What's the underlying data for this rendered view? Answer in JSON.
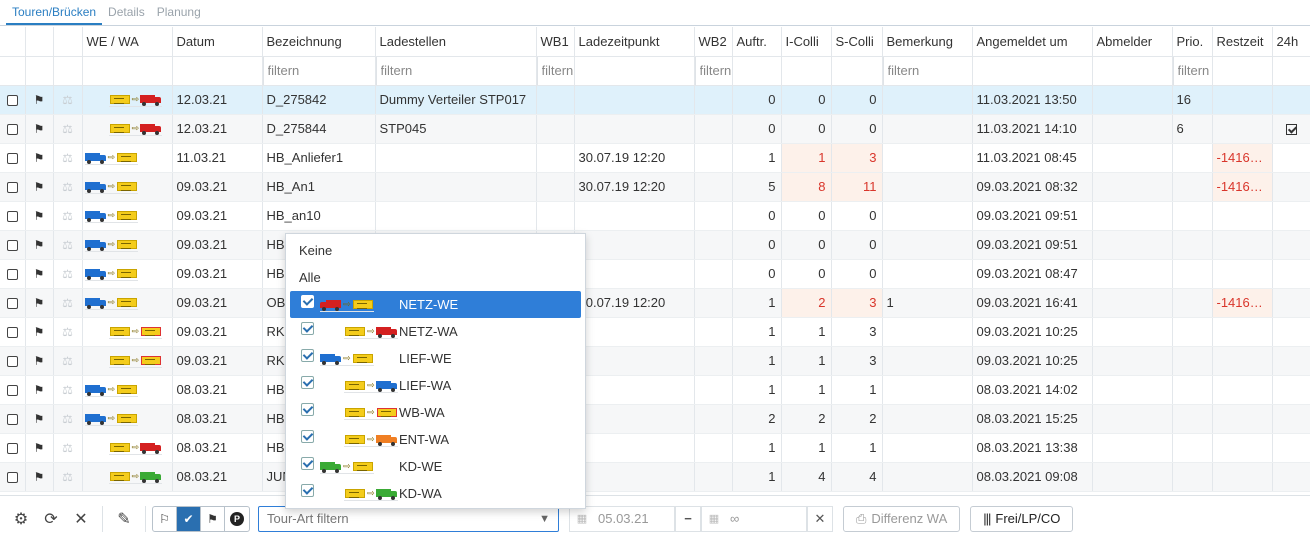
{
  "tabs": [
    "Touren/Brücken",
    "Details",
    "Planung"
  ],
  "columns": {
    "we_wa": "WE / WA",
    "datum": "Datum",
    "bezeichnung": "Bezeichnung",
    "ladestellen": "Ladestellen",
    "wb1": "WB1",
    "ladezeitpunkt": "Ladezeitpunkt",
    "wb2": "WB2",
    "auftr": "Auftr.",
    "icolli": "I-Colli",
    "scolli": "S-Colli",
    "bemerkung": "Bemerkung",
    "angemeldet": "Angemeldet um",
    "abmelder": "Abmelder",
    "prio": "Prio.",
    "restzeit": "Restzeit",
    "h24": "24h"
  },
  "filters": {
    "bezeichnung": "filtern",
    "ladestellen": "filtern",
    "wb1": "filtern",
    "wb2": "filtern",
    "bemerkung": "filtern",
    "prio": "filtern"
  },
  "rows": [
    {
      "tour": "NETZ-WA",
      "datum": "12.03.21",
      "bez": "D_275842",
      "lade": "Dummy Verteiler STP017",
      "ladezeit": "",
      "auftr": "0",
      "icolli": "0",
      "scolli": "0",
      "bem": "",
      "angem": "11.03.2021 13:50",
      "prio": "16",
      "rest": "",
      "h24": false
    },
    {
      "tour": "NETZ-WA",
      "datum": "12.03.21",
      "bez": "D_275844",
      "lade": "STP045",
      "ladezeit": "",
      "auftr": "0",
      "icolli": "0",
      "scolli": "0",
      "bem": "",
      "angem": "11.03.2021 14:10",
      "prio": "6",
      "rest": "",
      "h24": true
    },
    {
      "tour": "LIEF-WE",
      "datum": "11.03.21",
      "bez": "HB_Anliefer1",
      "lade": "",
      "ladezeit": "30.07.19 12:20",
      "auftr": "1",
      "icolli": "1",
      "scolli": "3",
      "bem": "",
      "angem": "11.03.2021 08:45",
      "prio": "",
      "rest": "-1416…",
      "h24": false
    },
    {
      "tour": "LIEF-WE",
      "datum": "09.03.21",
      "bez": "HB_An1",
      "lade": "",
      "ladezeit": "30.07.19 12:20",
      "auftr": "5",
      "icolli": "8",
      "scolli": "11",
      "bem": "",
      "angem": "09.03.2021 08:32",
      "prio": "",
      "rest": "-1416…",
      "h24": false
    },
    {
      "tour": "LIEF-WE",
      "datum": "09.03.21",
      "bez": "HB_an10",
      "lade": "",
      "ladezeit": "",
      "auftr": "0",
      "icolli": "0",
      "scolli": "0",
      "bem": "",
      "angem": "09.03.2021 09:51",
      "prio": "",
      "rest": "",
      "h24": false
    },
    {
      "tour": "LIEF-WE",
      "datum": "09.03.21",
      "bez": "HB",
      "lade": "",
      "ladezeit": "",
      "auftr": "0",
      "icolli": "0",
      "scolli": "0",
      "bem": "",
      "angem": "09.03.2021 09:51",
      "prio": "",
      "rest": "",
      "h24": false
    },
    {
      "tour": "LIEF-WE",
      "datum": "09.03.21",
      "bez": "HB",
      "lade": "",
      "ladezeit": "",
      "auftr": "0",
      "icolli": "0",
      "scolli": "0",
      "bem": "",
      "angem": "09.03.2021 08:47",
      "prio": "",
      "rest": "",
      "h24": false
    },
    {
      "tour": "LIEF-WE",
      "datum": "09.03.21",
      "bez": "OB",
      "lade": "",
      "ladezeit": "30.07.19 12:20",
      "auftr": "1",
      "icolli": "2",
      "scolli": "3",
      "bem": "1",
      "angem": "09.03.2021 16:41",
      "prio": "",
      "rest": "-1416…",
      "h24": false
    },
    {
      "tour": "WB-WA",
      "datum": "09.03.21",
      "bez": "RK",
      "lade": "",
      "ladezeit": "",
      "auftr": "1",
      "icolli": "1",
      "scolli": "3",
      "bem": "",
      "angem": "09.03.2021 10:25",
      "prio": "",
      "rest": "",
      "h24": false
    },
    {
      "tour": "WB-WA",
      "datum": "09.03.21",
      "bez": "RK",
      "lade": "",
      "ladezeit": "",
      "auftr": "1",
      "icolli": "1",
      "scolli": "3",
      "bem": "",
      "angem": "09.03.2021 10:25",
      "prio": "",
      "rest": "",
      "h24": false
    },
    {
      "tour": "LIEF-WE",
      "datum": "08.03.21",
      "bez": "HB",
      "lade": "",
      "ladezeit": "",
      "auftr": "1",
      "icolli": "1",
      "scolli": "1",
      "bem": "",
      "angem": "08.03.2021 14:02",
      "prio": "",
      "rest": "",
      "h24": false
    },
    {
      "tour": "LIEF-WE",
      "datum": "08.03.21",
      "bez": "HB",
      "lade": "",
      "ladezeit": "",
      "auftr": "2",
      "icolli": "2",
      "scolli": "2",
      "bem": "",
      "angem": "08.03.2021 15:25",
      "prio": "",
      "rest": "",
      "h24": false
    },
    {
      "tour": "NETZ-WA",
      "datum": "08.03.21",
      "bez": "HB",
      "lade": "",
      "ladezeit": "",
      "auftr": "1",
      "icolli": "1",
      "scolli": "1",
      "bem": "",
      "angem": "08.03.2021 13:38",
      "prio": "",
      "rest": "",
      "h24": false
    },
    {
      "tour": "KD-WA",
      "datum": "08.03.21",
      "bez": "JUN",
      "lade": "",
      "ladezeit": "",
      "auftr": "1",
      "icolli": "4",
      "scolli": "4",
      "bem": "",
      "angem": "08.03.2021 09:08",
      "prio": "",
      "rest": "",
      "h24": false
    }
  ],
  "dropdown": {
    "none": "Keine",
    "all": "Alle",
    "items": [
      {
        "label": "NETZ-WE",
        "checked": true,
        "active": true
      },
      {
        "label": "NETZ-WA",
        "checked": true,
        "active": false
      },
      {
        "label": "LIEF-WE",
        "checked": true,
        "active": false
      },
      {
        "label": "LIEF-WA",
        "checked": true,
        "active": false
      },
      {
        "label": "WB-WA",
        "checked": true,
        "active": false
      },
      {
        "label": "ENT-WA",
        "checked": true,
        "active": false
      },
      {
        "label": "KD-WE",
        "checked": true,
        "active": false
      },
      {
        "label": "KD-WA",
        "checked": true,
        "active": false
      }
    ]
  },
  "toolbar": {
    "tour_select_placeholder": "Tour-Art filtern",
    "date_from": "05.03.21",
    "date_to": "∞",
    "diff_button": "Differenz WA",
    "frei_button": "Frei/LP/CO"
  },
  "colors": {
    "accent": "#2f7ed8",
    "red_truck": "#d42020",
    "blue_truck": "#1f6fd0",
    "green_truck": "#3aaa35",
    "orange_truck": "#f07f23",
    "dock": "#f4cc1b"
  }
}
